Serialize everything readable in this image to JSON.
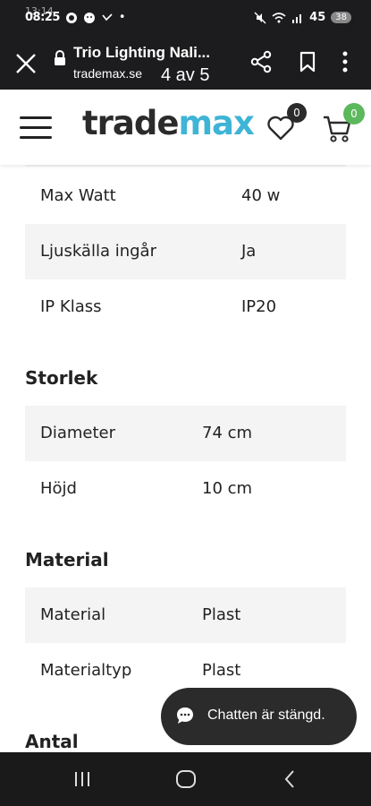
{
  "status_bar": {
    "time": "08:25",
    "overlay_time": "13:14",
    "battery": "45",
    "badge": "38",
    "dot": "•"
  },
  "browser": {
    "title": "Trio Lighting Nali...",
    "url": "trademax.se",
    "page_counter": "4 av 5"
  },
  "header": {
    "logo_part1": "trade",
    "logo_part2": "max",
    "wishlist_count": "0",
    "cart_count": "0",
    "colors": {
      "logo_dark": "#2b2b2b",
      "logo_accent": "#3fb4d6",
      "cart_badge": "#5cb85c"
    }
  },
  "specs": {
    "rows_top": [
      {
        "key": "Max Watt",
        "value": "40 w"
      },
      {
        "key": "Ljuskälla ingår",
        "value": "Ja"
      },
      {
        "key": "IP Klass",
        "value": "IP20"
      }
    ],
    "storlek_title": "Storlek",
    "storlek_rows": [
      {
        "key": "Diameter",
        "value": "74 cm"
      },
      {
        "key": "Höjd",
        "value": "10 cm"
      }
    ],
    "material_title": "Material",
    "material_rows": [
      {
        "key": "Material",
        "value": "Plast"
      },
      {
        "key": "Materialtyp",
        "value": "Plast"
      }
    ],
    "antal_title": "Antal"
  },
  "chat": {
    "label": "Chatten är stängd."
  },
  "icons": {
    "close": "close-icon",
    "lock": "lock-icon",
    "share": "share-icon",
    "bookmark": "bookmark-icon",
    "more": "more-vertical-icon",
    "menu": "hamburger-menu-icon",
    "wishlist": "heart-icon",
    "cart": "cart-icon",
    "chat": "chat-bubble-icon",
    "recent_apps": "recent-apps-icon",
    "home": "home-icon",
    "back": "back-icon"
  }
}
